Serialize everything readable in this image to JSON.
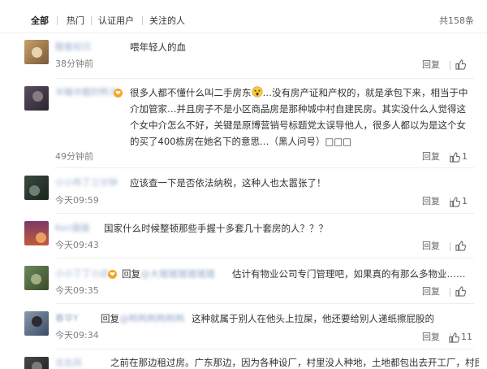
{
  "tabs": [
    {
      "label": "全部",
      "active": true
    },
    {
      "label": "热门",
      "active": false
    },
    {
      "label": "认证用户",
      "active": false
    },
    {
      "label": "关注的人",
      "active": false
    }
  ],
  "total": "共158条",
  "comments": [
    {
      "user": "醒着如沉",
      "text": "喂年轻人的血",
      "time": "38分钟前",
      "reply": "回复",
      "likes": ""
    },
    {
      "user": "半睡半醒的鸭子",
      "text": "很多人都不懂什么叫二手房东",
      "text2": "…没有房产证和产权的，就是承包下来，相当于中介加管家…并且房子不是小区商品房是那种城中村自建民房。其实没什么人觉得这个女中介怎么不好，关键是原博营销号标题党太误导他人，很多人都以为是这个女的买了400栋房在她名下的意思…（黑人问号）□□□",
      "time": "49分钟前",
      "reply": "回复",
      "likes": "1"
    },
    {
      "user": "小小布丁三分钟",
      "text": "应该查一下是否依法纳税，这种人也太嚣张了！",
      "time": "今天09:59",
      "reply": "回复",
      "likes": "1"
    },
    {
      "user": "Ken猫猫",
      "text": "国家什么时候整顿那些手握十多套几十套房的人？？？",
      "time": "今天09:43",
      "reply": "回复",
      "likes": ""
    },
    {
      "user": "小小丁丁小店",
      "reply_prefix": "回复",
      "reply_to": "@大猪猪猪猪猪猪",
      "text": "估计有物业公司专门管理吧，如果真的有那么多物业……",
      "time": "今天09:35",
      "reply": "回复",
      "likes": ""
    },
    {
      "user": "春华Y",
      "reply_prefix": "回复",
      "reply_to": "@鸭鸭鸭鸭鸭鸭",
      "text": "这种就属于别人在他头上拉屎，他还要给别人递纸擦屁股的",
      "time": "今天09:34",
      "reply": "回复",
      "likes": "11"
    },
    {
      "user": "北北风",
      "text": "之前在那边租过房。广东那边，因为各种设厂，村里没人种地，土地都包出去开工厂，村民一",
      "time": "",
      "reply": "",
      "likes": ""
    }
  ],
  "icons": {
    "like": "thumbs-up-icon",
    "emoji": "surprised-face-icon",
    "badge": "vip-badge-icon"
  },
  "colors": {
    "username": "#9aaecb",
    "text": "#333333",
    "time": "#808080",
    "badge": "#f5a623"
  }
}
